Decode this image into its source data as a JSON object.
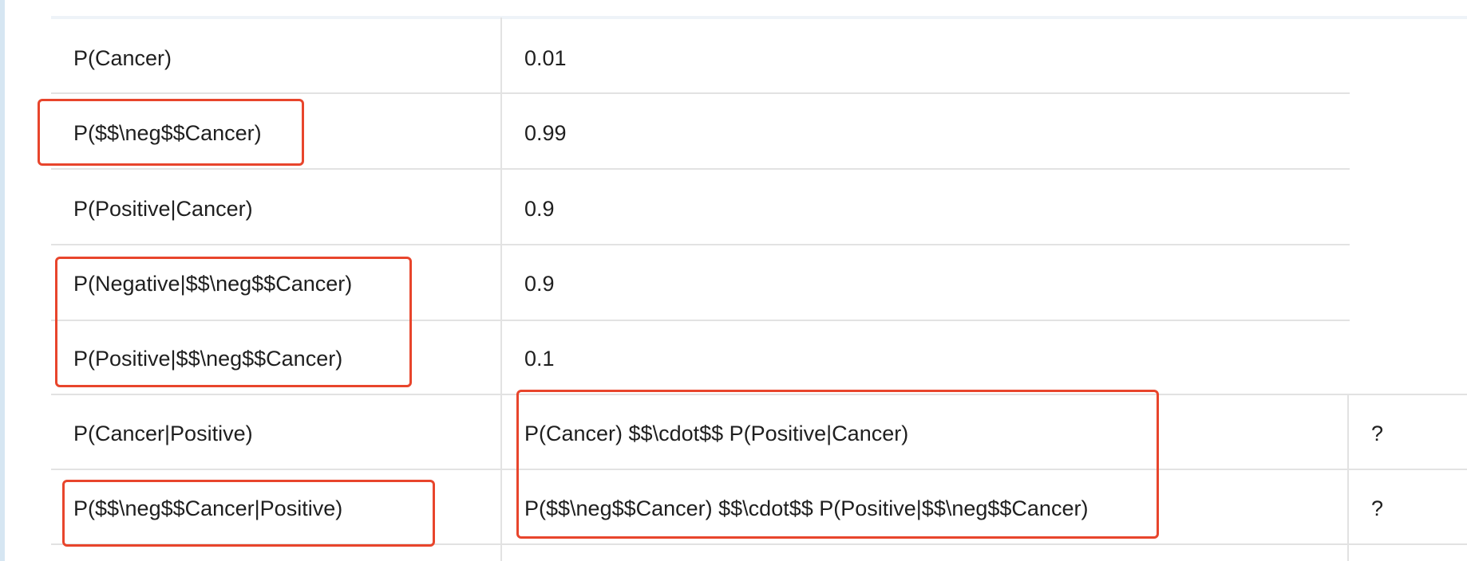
{
  "table": {
    "rows": [
      {
        "label": "P(Cancer)",
        "value": "0.01",
        "extra": ""
      },
      {
        "label": "P($$\\neg$$Cancer)",
        "value": "0.99",
        "extra": ""
      },
      {
        "label": "P(Positive|Cancer)",
        "value": "0.9",
        "extra": ""
      },
      {
        "label": "P(Negative|$$\\neg$$Cancer)",
        "value": "0.9",
        "extra": ""
      },
      {
        "label": "P(Positive|$$\\neg$$Cancer)",
        "value": "0.1",
        "extra": ""
      },
      {
        "label": "P(Cancer|Positive)",
        "value": "P(Cancer) $$\\cdot$$ P(Positive|Cancer)",
        "extra": "?"
      },
      {
        "label": "P($$\\neg$$Cancer|Positive)",
        "value": "P($$\\neg$$Cancer) $$\\cdot$$ P(Positive|$$\\neg$$Cancer)",
        "extra": "?"
      }
    ]
  },
  "colors": {
    "highlight": "#e8452c",
    "grid": "#e2e2e2",
    "frame": "#d6e6f2"
  }
}
